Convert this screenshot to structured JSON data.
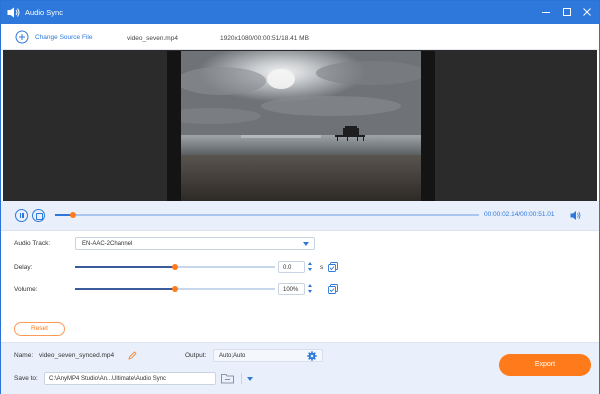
{
  "window": {
    "title": "Audio Sync"
  },
  "toolbar": {
    "change_source_label": "Change Source File",
    "file_name": "video_seven.mp4",
    "file_info": "1920x1080/00:00:51/18.41 MB"
  },
  "playback": {
    "timecode": "00:00:02.14/00:00:51.01",
    "progress_fraction": 0.042
  },
  "settings": {
    "audio_track_label": "Audio Track:",
    "audio_track_value": "EN-AAC-2Channel",
    "delay_label": "Delay:",
    "delay_value": "0.0",
    "delay_unit": "s",
    "delay_fraction": 0.5,
    "volume_label": "Volume:",
    "volume_value": "100%",
    "volume_fraction": 0.5,
    "reset_label": "Reset"
  },
  "output": {
    "name_label": "Name:",
    "name_value": "video_seven_synced.mp4",
    "output_label": "Output:",
    "output_value": "Auto;Auto",
    "save_to_label": "Save to:",
    "save_to_value": "C:\\AnyMP4 Studio\\An...Ultimate\\Audio Sync",
    "export_label": "Export"
  },
  "colors": {
    "accent": "#2e78dc",
    "orange": "#ff7a1a",
    "panel": "#e9f0fb"
  }
}
